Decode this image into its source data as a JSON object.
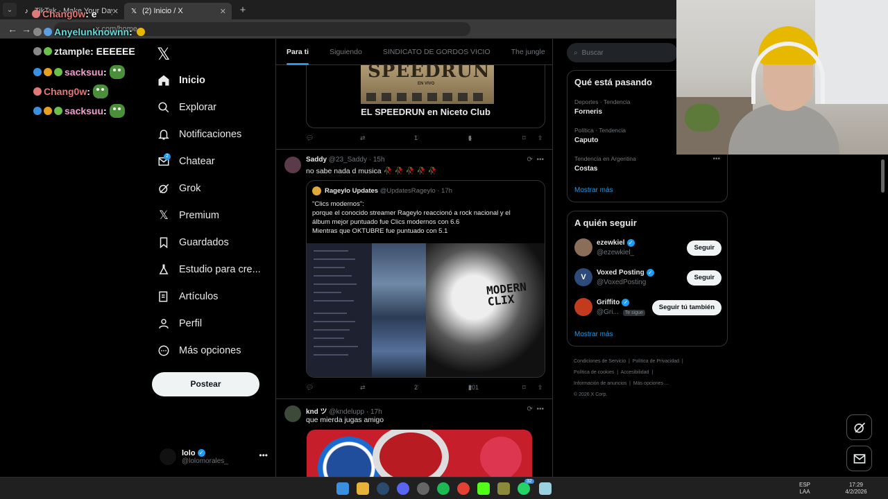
{
  "browser": {
    "tabs": [
      {
        "title": "TikTok - Make Your Day",
        "close": "✕"
      },
      {
        "title": "(2) Inicio / X",
        "close": "✕"
      }
    ],
    "new_tab": "+",
    "url_partial": "x.com/home"
  },
  "chat": {
    "messages": [
      {
        "user": "Chang0w",
        "text": ": e",
        "user_color": "#e07a7a"
      },
      {
        "user": "Anyelunknownn",
        "text": ":",
        "user_color": "#66d9d9"
      },
      {
        "user": "ztample",
        "text": ": EEEEEE",
        "user_color": "#e6e6e6"
      },
      {
        "user": "sacksuu",
        "text": ":",
        "user_color": "#f0a0d0"
      },
      {
        "user": "Chang0w",
        "text": ":",
        "user_color": "#e07a7a"
      },
      {
        "user": "sacksuu",
        "text": ":",
        "user_color": "#f0a0d0"
      }
    ]
  },
  "nav": {
    "logo": "𝕏",
    "items": [
      {
        "label": "Inicio",
        "icon": "home-icon"
      },
      {
        "label": "Explorar",
        "icon": "search-icon"
      },
      {
        "label": "Notificaciones",
        "icon": "bell-icon"
      },
      {
        "label": "Chatear",
        "icon": "mail-icon",
        "badge": "2"
      },
      {
        "label": "Grok",
        "icon": "grok-icon"
      },
      {
        "label": "Premium",
        "icon": "x-icon"
      },
      {
        "label": "Guardados",
        "icon": "bookmark-icon"
      },
      {
        "label": "Estudio para cre...",
        "icon": "flask-icon"
      },
      {
        "label": "Artículos",
        "icon": "article-icon"
      },
      {
        "label": "Perfil",
        "icon": "person-icon"
      },
      {
        "label": "Más opciones",
        "icon": "more-circle-icon"
      }
    ],
    "post_button": "Postear",
    "account": {
      "name": "lolo",
      "handle": "@lolomorales_",
      "more": "•••"
    }
  },
  "feed": {
    "tabs": [
      "Para ti",
      "Siguiendo",
      "SINDICATO DE GORDOS VICIO",
      "The jungle"
    ],
    "card_top": {
      "image_text": "SPEEDRUN",
      "image_sub": "EN VIVO",
      "caption": "EL SPEEDRUN en Niceto Club",
      "actions": {
        "reply": "",
        "repost": "",
        "like": "1",
        "views": "6"
      }
    },
    "tweet1": {
      "name": "Saddy",
      "meta": "@23_Saddy · 15h",
      "text": "no sabe nada d musica 🥀 🥀 🥀 🥀 🥀",
      "quote": {
        "name": "Rageylo Updates",
        "meta": "@UpdatesRageylo · 17h",
        "lines": [
          "\"Clics modernos\":",
          "porque el conocido streamer Rageylo reaccionó a rock nacional y el",
          "álbum mejor puntuado fue Clics modernos con 6.6",
          "Mientras que OKTUBRE fue puntuado con 5.1"
        ],
        "image_text": "MODERN\nCLIX"
      },
      "actions": {
        "reply": "",
        "repost": "",
        "like": "2",
        "views": "201"
      }
    },
    "tweet2": {
      "name": "knd ツ",
      "meta": "@kndelupp · 17h",
      "text": "que mierda jugas amigo"
    }
  },
  "right": {
    "search_placeholder": "Buscar",
    "trends_title": "Qué está pasando",
    "trends": [
      {
        "context": "Deportes · Tendencia",
        "name": "Forneris"
      },
      {
        "context": "Política · Tendencia",
        "name": "Caputo"
      },
      {
        "context": "Tendencia en Argentina",
        "name": "Costas"
      }
    ],
    "trends_more": "Mostrar más",
    "follow_title": "A quién seguir",
    "follow": [
      {
        "name": "ezewkiel",
        "handle": "@ezewkiel_",
        "button": "Seguir",
        "avatar_color": "#8a6e5a"
      },
      {
        "name": "Voxed Posting",
        "handle": "@VoxedPosting",
        "button": "Seguir",
        "avatar_color": "#2c4a7a",
        "avatar_letter": "V"
      },
      {
        "name": "Griffito",
        "handle": "@Gri...",
        "button": "Seguir tú también",
        "follows_you": "Te sigue",
        "avatar_color": "#c23b1c"
      }
    ],
    "follow_more": "Mostrar más",
    "footer": [
      [
        "Condiciones de Servicio",
        "Política de Privacidad"
      ],
      [
        "Política de cookies",
        "Accesibilidad"
      ],
      [
        "Información de anuncios",
        "Más opciones ..."
      ],
      [
        "© 2026 X Corp."
      ]
    ]
  },
  "taskbar": {
    "lang": "ESP",
    "layout": "LAA",
    "time": "17:29",
    "date": "4/2/2026",
    "whatsapp_badge": "32"
  }
}
